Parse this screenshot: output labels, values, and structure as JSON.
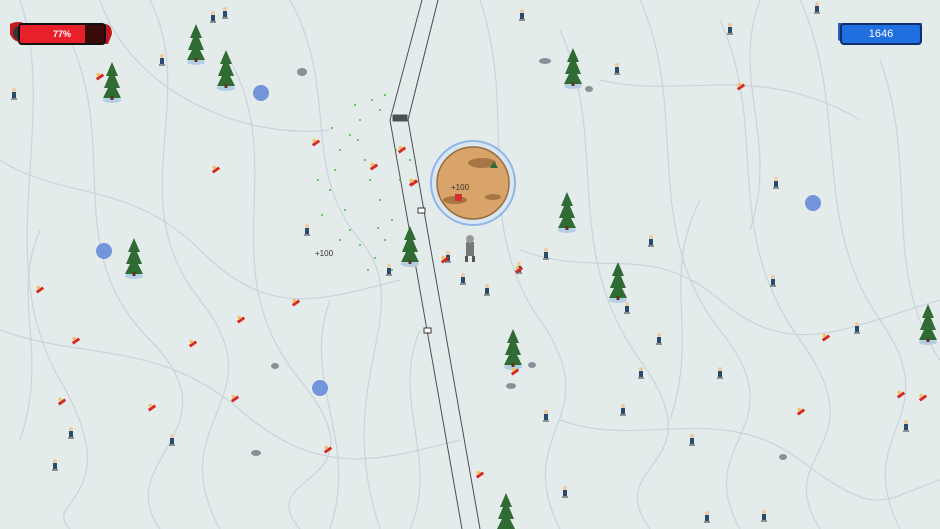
{
  "game": {
    "title": "",
    "health_percent": 77,
    "health_label": "77%",
    "score": "1646",
    "popup_points_1": "+100",
    "popup_points_2": "+100"
  },
  "colors": {
    "snow": "#e4eceb",
    "track": "#c9d3dc",
    "health": "#e8202a",
    "score": "#1f6fe0",
    "pine": "#2f6b33",
    "ice_patch": "#5f86d8"
  },
  "entities": {
    "trees": 13,
    "skiers": "many",
    "ice_patches": 5,
    "rocks": 8,
    "lift_cable": true,
    "dirt_island": true
  }
}
